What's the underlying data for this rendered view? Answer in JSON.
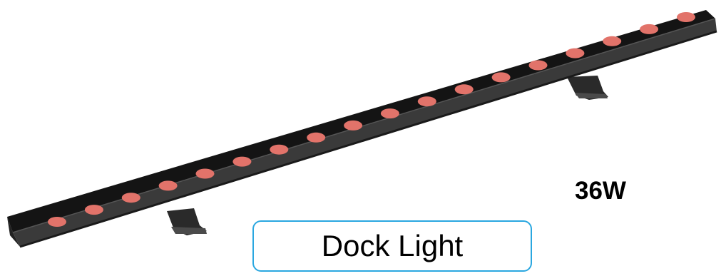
{
  "product": {
    "wattage": "36W",
    "label": "Dock Light",
    "led_count": 18,
    "colors": {
      "housing": "#141414",
      "housing_side": "#3a3a3a",
      "led": "#e2736a",
      "label_border": "#2aa7e0"
    }
  }
}
